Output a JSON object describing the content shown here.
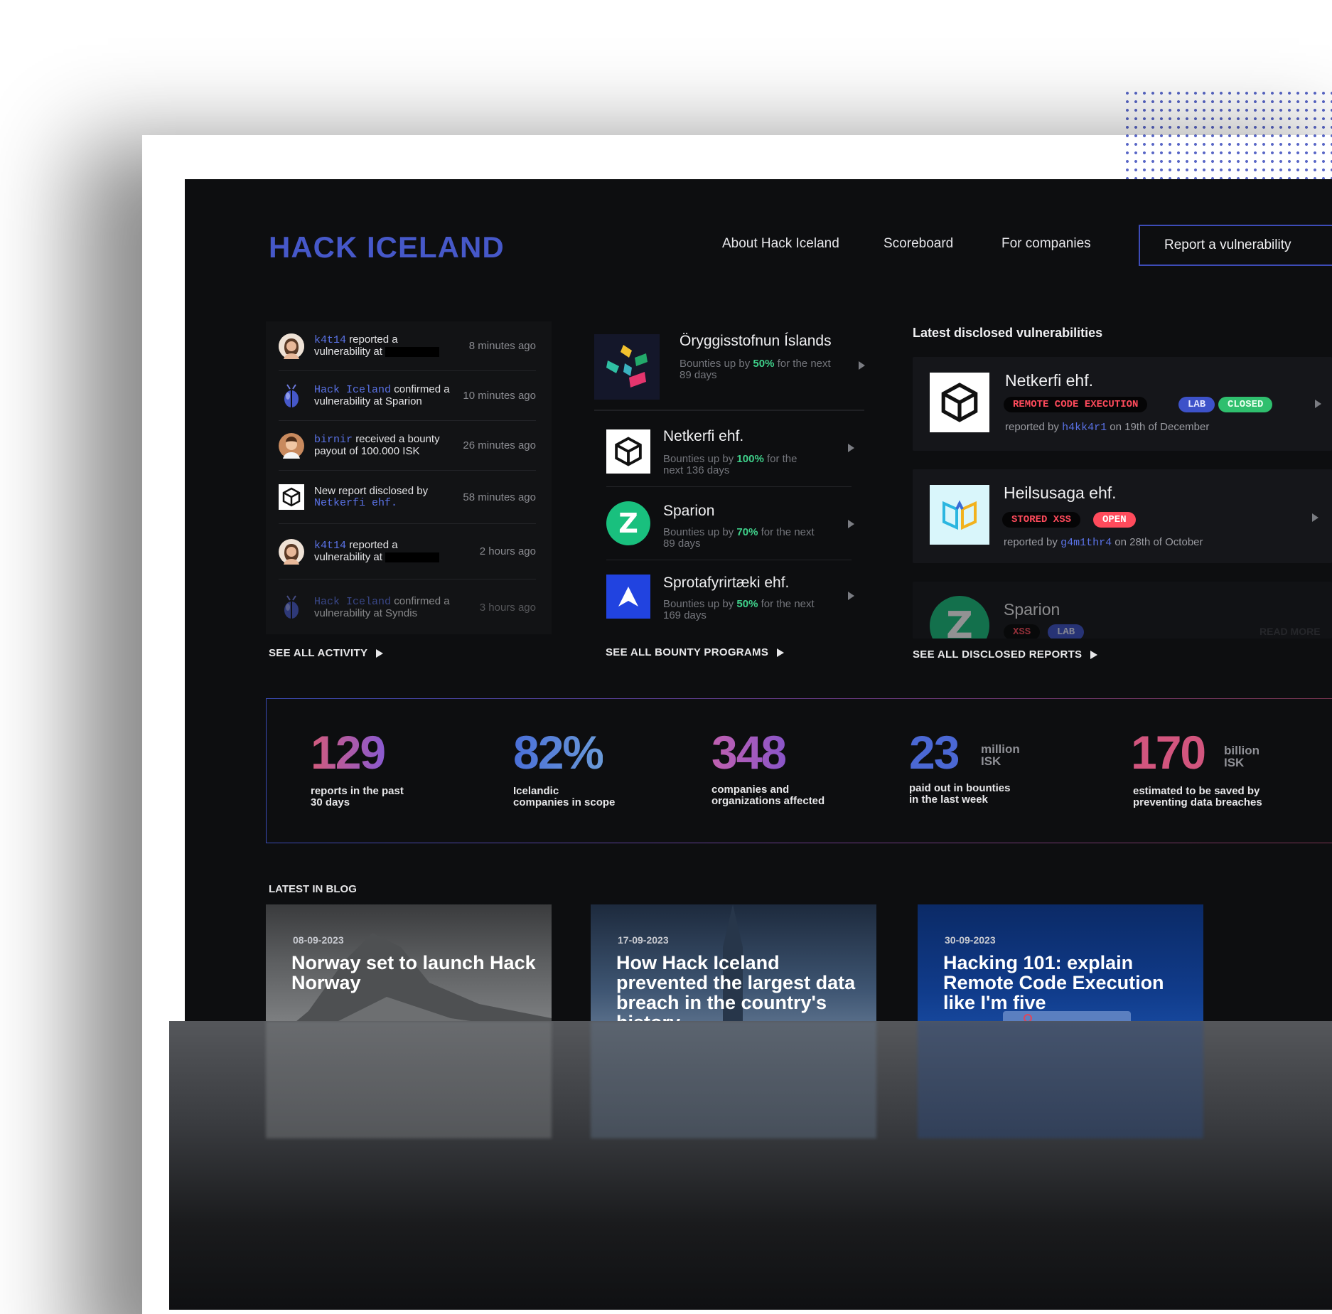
{
  "brand": {
    "logo": "HACK ICELAND",
    "accent": "#4658c9"
  },
  "nav": {
    "about": "About Hack Iceland",
    "scoreboard": "Scoreboard",
    "companies": "For companies",
    "report_button": "Report a vulnerability"
  },
  "activity": {
    "items": [
      {
        "user": "k4t14",
        "text": "reported a vulnerability at",
        "time": "8 minutes ago",
        "avatar": "woman-avatar"
      },
      {
        "user": "Hack Iceland",
        "text": "confirmed a vulnerability at Sparion",
        "time": "10 minutes ago",
        "avatar": "bug-icon"
      },
      {
        "user": "birnir",
        "text": "received a bounty payout of 100.000 ISK",
        "time": "26 minutes ago",
        "avatar": "man-avatar"
      },
      {
        "pre": "New report disclosed by",
        "user": "Netkerfi ehf.",
        "time": "58 minutes ago",
        "avatar": "cube-logo-icon"
      },
      {
        "user": "k4t14",
        "text": "reported a vulnerability at",
        "time": "2 hours ago",
        "avatar": "woman-avatar"
      },
      {
        "user": "Hack Iceland",
        "text": "confirmed a vulnerability at Syndis",
        "time": "3 hours ago",
        "avatar": "bug-icon"
      }
    ],
    "see_all": "SEE ALL ACTIVITY"
  },
  "programs": {
    "featured": {
      "name": "Öryggisstofnun Íslands",
      "pre": "Bounties up by",
      "pct": "50%",
      "post": "for the next 89 days"
    },
    "items": [
      {
        "name": "Netkerfi ehf.",
        "pre": "Bounties up by",
        "pct": "100%",
        "post": "for the next 136 days"
      },
      {
        "name": "Sparion",
        "pre": "Bounties up by",
        "pct": "70%",
        "post": "for the next 89 days"
      },
      {
        "name": "Sprotafyrirtæki ehf.",
        "pre": "Bounties up by",
        "pct": "50%",
        "post": "for the next 169 days"
      }
    ],
    "see_all": "SEE ALL BOUNTY PROGRAMS"
  },
  "disclosed": {
    "title": "Latest disclosed vulnerabilities",
    "items": [
      {
        "name": "Netkerfi ehf.",
        "tags": [
          "REMOTE CODE EXECUTION",
          "LAB",
          "CLOSED"
        ],
        "by_pre": "reported by",
        "user": "h4kk4r1",
        "by_post": "on 19th of December"
      },
      {
        "name": "Heilsusaga ehf.",
        "tags": [
          "STORED XSS",
          "OPEN"
        ],
        "by_pre": "reported by",
        "user": "g4m1thr4",
        "by_post": "on 28th of October"
      },
      {
        "name": "Sparion",
        "tags": [
          "XSS",
          "LAB"
        ],
        "read_more": "READ MORE"
      }
    ],
    "see_all": "SEE ALL DISCLOSED REPORTS"
  },
  "stats": [
    {
      "value": "129",
      "caption_1": "reports in the past",
      "caption_2": "30 days",
      "color": "#c25f9a"
    },
    {
      "value": "82%",
      "caption_1": "Icelandic",
      "caption_2": "companies in scope",
      "color": "#4d7dd6"
    },
    {
      "value": "348",
      "caption_1": "companies and",
      "caption_2": "organizations affected",
      "color": "#a453b8"
    },
    {
      "value": "23",
      "unit_1": "million",
      "unit_2": "ISK",
      "caption_1": "paid out in bounties",
      "caption_2": "in the last week",
      "color": "#4b68d4"
    },
    {
      "value": "170",
      "unit_1": "billion",
      "unit_2": "ISK",
      "caption_1": "estimated to be saved by",
      "caption_2": "preventing data breaches",
      "color": "#d2557e"
    }
  ],
  "blog": {
    "title": "LATEST IN BLOG",
    "items": [
      {
        "date": "08-09-2023",
        "headline": "Norway set to launch Hack Norway"
      },
      {
        "date": "17-09-2023",
        "headline": "How Hack Iceland prevented the largest data breach in the country's history"
      },
      {
        "date": "30-09-2023",
        "headline": "Hacking 101: explain Remote Code Execution like I'm five"
      }
    ]
  }
}
